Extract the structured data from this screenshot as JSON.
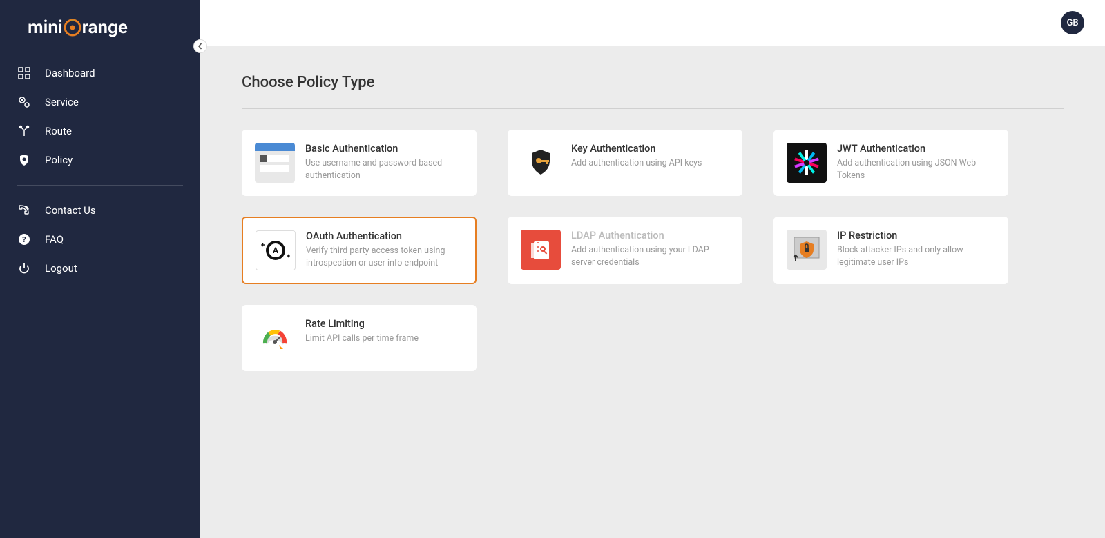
{
  "brand": {
    "name": "miniOrange"
  },
  "sidebar": {
    "nav": [
      {
        "id": "dashboard",
        "label": "Dashboard"
      },
      {
        "id": "service",
        "label": "Service"
      },
      {
        "id": "route",
        "label": "Route"
      },
      {
        "id": "policy",
        "label": "Policy"
      }
    ],
    "support": [
      {
        "id": "contact",
        "label": "Contact Us"
      },
      {
        "id": "faq",
        "label": "FAQ"
      },
      {
        "id": "logout",
        "label": "Logout"
      }
    ]
  },
  "header": {
    "avatar_initials": "GB"
  },
  "page": {
    "title": "Choose Policy Type"
  },
  "policies": [
    {
      "id": "basic",
      "title": "Basic Authentication",
      "desc": "Use username and password based authentication",
      "selected": false,
      "disabled": false
    },
    {
      "id": "key",
      "title": "Key Authentication",
      "desc": "Add authentication using API keys",
      "selected": false,
      "disabled": false
    },
    {
      "id": "jwt",
      "title": "JWT Authentication",
      "desc": "Add authentication using JSON Web Tokens",
      "selected": false,
      "disabled": false
    },
    {
      "id": "oauth",
      "title": "OAuth Authentication",
      "desc": "Verify third party access token using introspection or user info endpoint",
      "selected": true,
      "disabled": false
    },
    {
      "id": "ldap",
      "title": "LDAP Authentication",
      "desc": "Add authentication using your LDAP server credentials",
      "selected": false,
      "disabled": true
    },
    {
      "id": "ip",
      "title": "IP Restriction",
      "desc": "Block attacker IPs and only allow legitimate user IPs",
      "selected": false,
      "disabled": false
    },
    {
      "id": "rate",
      "title": "Rate Limiting",
      "desc": "Limit API calls per time frame",
      "selected": false,
      "disabled": false
    }
  ]
}
